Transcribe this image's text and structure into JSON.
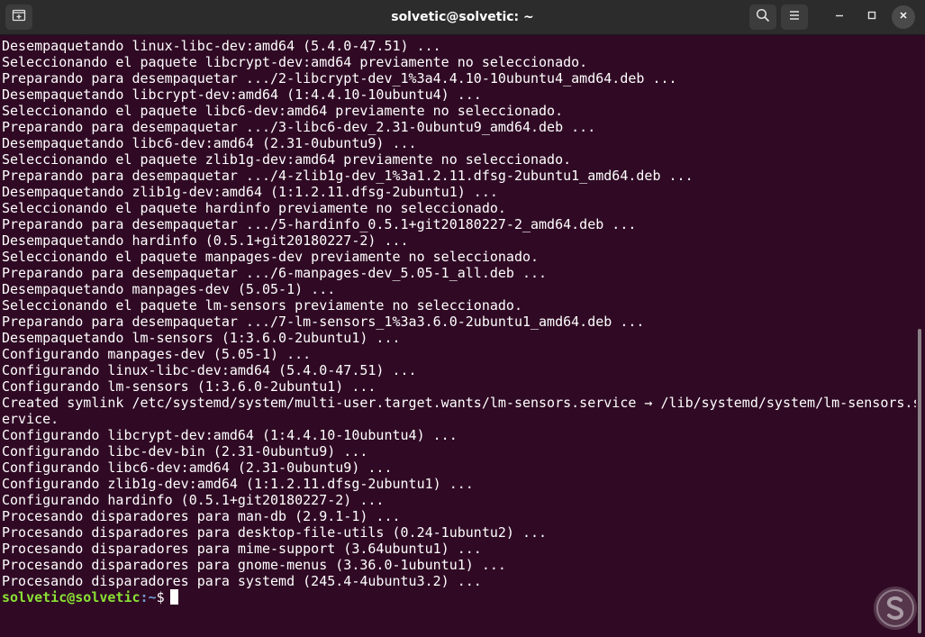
{
  "window": {
    "title": "solvetic@solvetic: ~"
  },
  "icons": {
    "new_tab": "new-tab-icon",
    "search": "search-icon",
    "menu": "hamburger-menu-icon",
    "minimize": "minimize-icon",
    "maximize": "maximize-icon",
    "close": "close-icon",
    "watermark": "solvetic-logo"
  },
  "colors": {
    "terminal_bg": "#300a24",
    "titlebar_bg": "#2c2c2c",
    "prompt_user": "#8ae234",
    "prompt_path": "#729fcf",
    "text": "#ffffff"
  },
  "terminal": {
    "lines": [
      "Desempaquetando linux-libc-dev:amd64 (5.4.0-47.51) ...",
      "Seleccionando el paquete libcrypt-dev:amd64 previamente no seleccionado.",
      "Preparando para desempaquetar .../2-libcrypt-dev_1%3a4.4.10-10ubuntu4_amd64.deb ...",
      "Desempaquetando libcrypt-dev:amd64 (1:4.4.10-10ubuntu4) ...",
      "Seleccionando el paquete libc6-dev:amd64 previamente no seleccionado.",
      "Preparando para desempaquetar .../3-libc6-dev_2.31-0ubuntu9_amd64.deb ...",
      "Desempaquetando libc6-dev:amd64 (2.31-0ubuntu9) ...",
      "Seleccionando el paquete zlib1g-dev:amd64 previamente no seleccionado.",
      "Preparando para desempaquetar .../4-zlib1g-dev_1%3a1.2.11.dfsg-2ubuntu1_amd64.deb ...",
      "Desempaquetando zlib1g-dev:amd64 (1:1.2.11.dfsg-2ubuntu1) ...",
      "Seleccionando el paquete hardinfo previamente no seleccionado.",
      "Preparando para desempaquetar .../5-hardinfo_0.5.1+git20180227-2_amd64.deb ...",
      "Desempaquetando hardinfo (0.5.1+git20180227-2) ...",
      "Seleccionando el paquete manpages-dev previamente no seleccionado.",
      "Preparando para desempaquetar .../6-manpages-dev_5.05-1_all.deb ...",
      "Desempaquetando manpages-dev (5.05-1) ...",
      "Seleccionando el paquete lm-sensors previamente no seleccionado.",
      "Preparando para desempaquetar .../7-lm-sensors_1%3a3.6.0-2ubuntu1_amd64.deb ...",
      "Desempaquetando lm-sensors (1:3.6.0-2ubuntu1) ...",
      "Configurando manpages-dev (5.05-1) ...",
      "Configurando linux-libc-dev:amd64 (5.4.0-47.51) ...",
      "Configurando lm-sensors (1:3.6.0-2ubuntu1) ...",
      "Created symlink /etc/systemd/system/multi-user.target.wants/lm-sensors.service → /lib/systemd/system/lm-sensors.s",
      "ervice.",
      "Configurando libcrypt-dev:amd64 (1:4.4.10-10ubuntu4) ...",
      "Configurando libc-dev-bin (2.31-0ubuntu9) ...",
      "Configurando libc6-dev:amd64 (2.31-0ubuntu9) ...",
      "Configurando zlib1g-dev:amd64 (1:1.2.11.dfsg-2ubuntu1) ...",
      "Configurando hardinfo (0.5.1+git20180227-2) ...",
      "Procesando disparadores para man-db (2.9.1-1) ...",
      "Procesando disparadores para desktop-file-utils (0.24-1ubuntu2) ...",
      "Procesando disparadores para mime-support (3.64ubuntu1) ...",
      "Procesando disparadores para gnome-menus (3.36.0-1ubuntu1) ...",
      "Procesando disparadores para systemd (245.4-4ubuntu3.2) ..."
    ],
    "prompt": {
      "user_host": "solvetic@solvetic",
      "path": ":~",
      "symbol": "$"
    }
  }
}
